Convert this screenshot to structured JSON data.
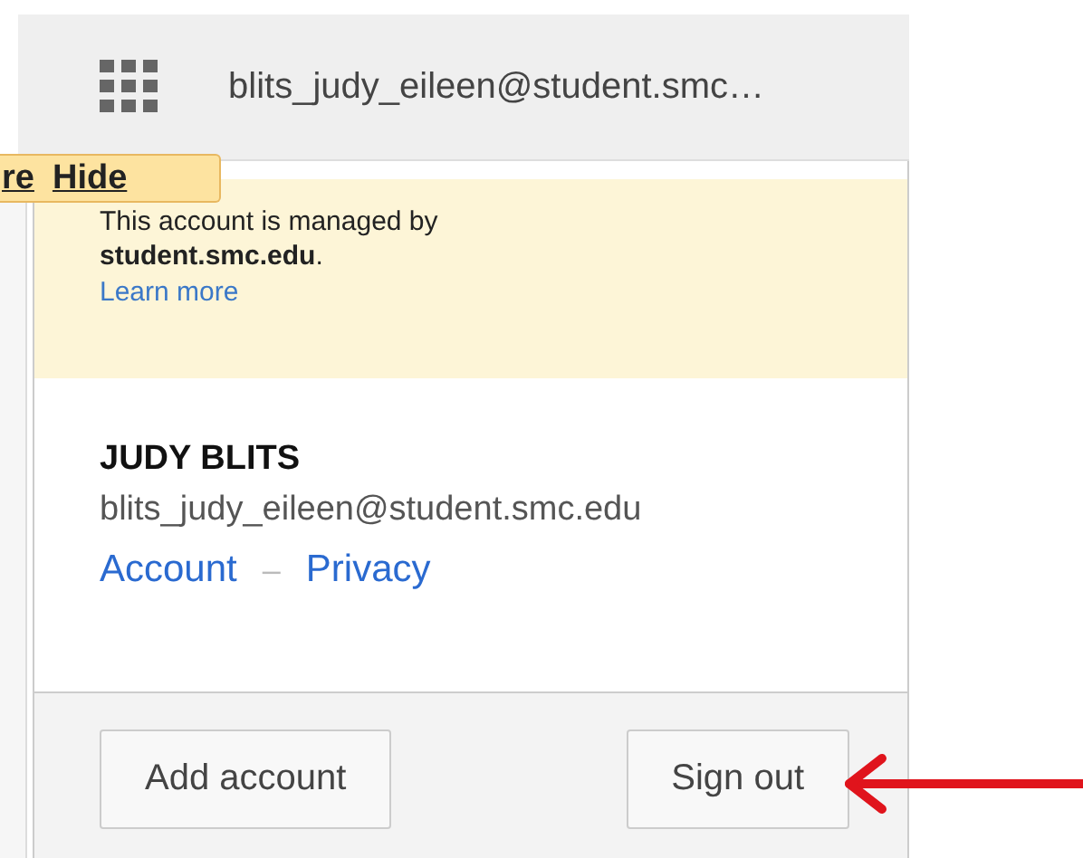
{
  "top_bar": {
    "account_label": "blits_judy_eileen@student.smc…"
  },
  "tooltip": {
    "links": [
      "re",
      "Hide"
    ]
  },
  "notice": {
    "text": "This account is managed by **student.smc.edu**.",
    "link": "Learn more"
  },
  "profile": {
    "name": "JUDY BLITS",
    "email": "blits_judy_eileen@student.smc.edu",
    "links": [
      "Account",
      "Privacy"
    ],
    "separator": "–"
  },
  "buttons": [
    "Add account",
    "Sign out"
  ]
}
